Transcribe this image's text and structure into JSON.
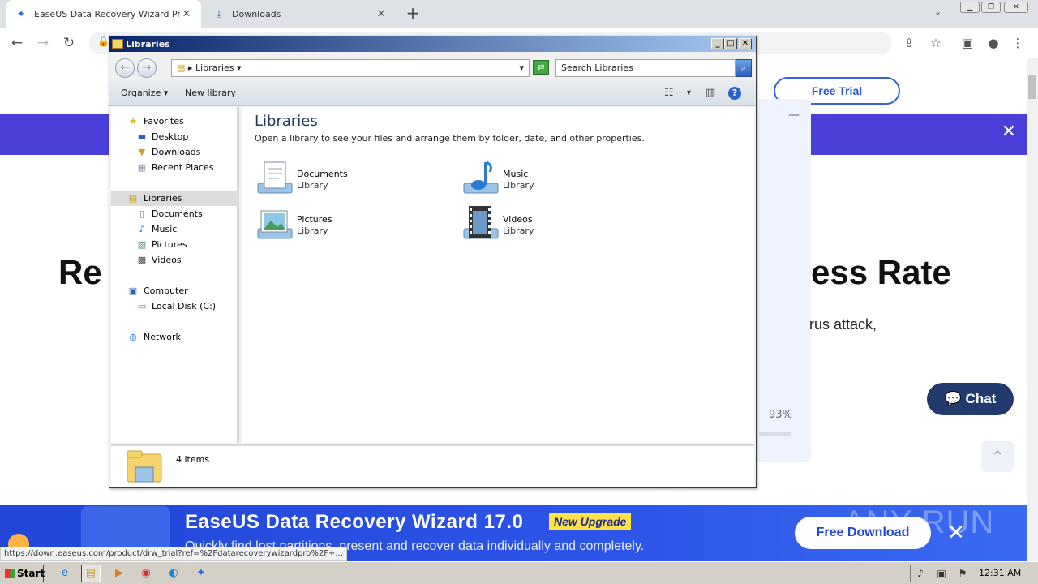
{
  "browser": {
    "tabs": [
      {
        "title": "EaseUS Data Recovery Wizard Profe",
        "icon": "easeus-favicon"
      },
      {
        "title": "Downloads",
        "icon": "download-icon"
      }
    ],
    "new_tab": "+"
  },
  "website": {
    "free_trial": "Free Trial",
    "headline_left": "Re",
    "headline_right": "ess Rate",
    "subtext_right": "rus attack,",
    "percent": "93%",
    "chat": "Chat",
    "banner": {
      "title": "EaseUS Data Recovery Wizard 17.0",
      "badge": "New Upgrade",
      "subtitle": "Quickly find lost partitions, present and recover data individually and completely.",
      "button": "Free Download",
      "watermark": "ANY RUN"
    },
    "status_url": "https://down.easeus.com/product/drw_trial?ref=%2Fdatarecoverywizardpro%2F+..."
  },
  "explorer": {
    "title": "Libraries",
    "address": "Libraries",
    "search_placeholder": "Search Libraries",
    "commands": {
      "organize": "Organize",
      "new_library": "New library"
    },
    "nav": {
      "favorites": "Favorites",
      "desktop": "Desktop",
      "downloads": "Downloads",
      "recent_places": "Recent Places",
      "libraries": "Libraries",
      "documents": "Documents",
      "music": "Music",
      "pictures": "Pictures",
      "videos": "Videos",
      "computer": "Computer",
      "local_disk": "Local Disk (C:)",
      "network": "Network"
    },
    "heading": "Libraries",
    "description": "Open a library to see your files and arrange them by folder, date, and other properties.",
    "libraries": [
      {
        "name": "Documents",
        "type": "Library"
      },
      {
        "name": "Music",
        "type": "Library"
      },
      {
        "name": "Pictures",
        "type": "Library"
      },
      {
        "name": "Videos",
        "type": "Library"
      }
    ],
    "status": "4 items"
  },
  "taskbar": {
    "start": "Start",
    "clock": "12:31 AM"
  },
  "colors": {
    "site_purple": "#4a3fd8",
    "banner_blue": "#2146d8",
    "chat_navy": "#233a6e",
    "title_bar": "#0a246a"
  }
}
